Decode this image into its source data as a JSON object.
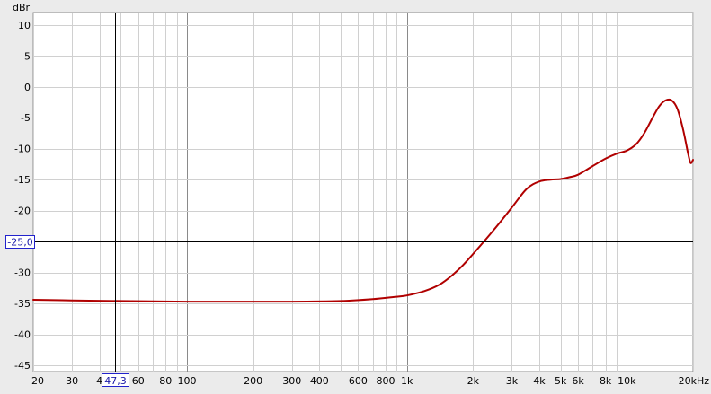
{
  "chart_data": {
    "type": "line",
    "x_scale": "log",
    "xlim": [
      20,
      20000
    ],
    "ylim": [
      -46,
      12
    ],
    "y_unit_label": "dBr",
    "x_unit_label": "kHz",
    "y_tick_labels": [
      {
        "v": 10,
        "t": "10"
      },
      {
        "v": 5,
        "t": "5"
      },
      {
        "v": 0,
        "t": "0"
      },
      {
        "v": -5,
        "t": "-5"
      },
      {
        "v": -10,
        "t": "-10"
      },
      {
        "v": -15,
        "t": "-15"
      },
      {
        "v": -20,
        "t": "-20"
      },
      {
        "v": -30,
        "t": "-30"
      },
      {
        "v": -35,
        "t": "-35"
      },
      {
        "v": -40,
        "t": "-40"
      },
      {
        "v": -45,
        "t": "-45"
      }
    ],
    "x_tick_labels": [
      {
        "v": 20,
        "t": "20"
      },
      {
        "v": 30,
        "t": "30"
      },
      {
        "v": 40,
        "t": "4"
      },
      {
        "v": 60,
        "t": "60"
      },
      {
        "v": 80,
        "t": "80"
      },
      {
        "v": 100,
        "t": "100"
      },
      {
        "v": 200,
        "t": "200"
      },
      {
        "v": 300,
        "t": "300"
      },
      {
        "v": 400,
        "t": "400"
      },
      {
        "v": 600,
        "t": "600"
      },
      {
        "v": 800,
        "t": "800"
      },
      {
        "v": 1000,
        "t": "1k"
      },
      {
        "v": 2000,
        "t": "2k"
      },
      {
        "v": 3000,
        "t": "3k"
      },
      {
        "v": 4000,
        "t": "4k"
      },
      {
        "v": 5000,
        "t": "5k"
      },
      {
        "v": 6000,
        "t": "6k"
      },
      {
        "v": 8000,
        "t": "8k"
      },
      {
        "v": 10000,
        "t": "10k"
      },
      {
        "v": 20000,
        "t": "20kHz"
      }
    ],
    "cursor": {
      "x_value": 47.3,
      "x_label": "47,3",
      "y_value": -25.0,
      "y_label": "-25,0"
    },
    "grid": true,
    "series": [
      {
        "color": "#b00000",
        "points": [
          [
            20,
            -34.4
          ],
          [
            30,
            -34.5
          ],
          [
            50,
            -34.6
          ],
          [
            100,
            -34.7
          ],
          [
            200,
            -34.7
          ],
          [
            300,
            -34.7
          ],
          [
            500,
            -34.6
          ],
          [
            700,
            -34.3
          ],
          [
            900,
            -33.9
          ],
          [
            1000,
            -33.7
          ],
          [
            1200,
            -33.0
          ],
          [
            1400,
            -32.0
          ],
          [
            1600,
            -30.5
          ],
          [
            1800,
            -28.8
          ],
          [
            2000,
            -27.0
          ],
          [
            2500,
            -23.0
          ],
          [
            3000,
            -19.5
          ],
          [
            3500,
            -16.5
          ],
          [
            4000,
            -15.3
          ],
          [
            4500,
            -15.0
          ],
          [
            5000,
            -14.9
          ],
          [
            5500,
            -14.6
          ],
          [
            6000,
            -14.2
          ],
          [
            7000,
            -12.8
          ],
          [
            8000,
            -11.6
          ],
          [
            9000,
            -10.8
          ],
          [
            10000,
            -10.3
          ],
          [
            11000,
            -9.3
          ],
          [
            12000,
            -7.5
          ],
          [
            13000,
            -5.2
          ],
          [
            14000,
            -3.2
          ],
          [
            15000,
            -2.2
          ],
          [
            16000,
            -2.2
          ],
          [
            17000,
            -3.6
          ],
          [
            18000,
            -6.8
          ],
          [
            19000,
            -10.8
          ],
          [
            19500,
            -12.3
          ],
          [
            20000,
            -11.8
          ]
        ]
      }
    ]
  }
}
